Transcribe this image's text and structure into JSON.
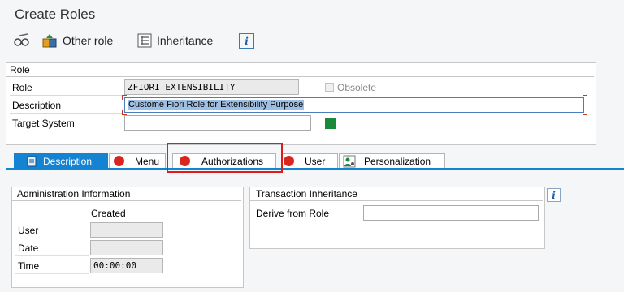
{
  "title": "Create Roles",
  "toolbar": {
    "other_role_label": "Other role",
    "inheritance_label": "Inheritance"
  },
  "role_group": {
    "title": "Role",
    "role_label": "Role",
    "role_value": "ZFIORI_EXTENSIBILITY",
    "obsolete_label": "Obsolete",
    "description_label": "Description",
    "description_value": "Custome Fiori Role for Extensibility Purpose",
    "target_system_label": "Target System",
    "target_system_value": ""
  },
  "tabs": [
    {
      "label": "Description",
      "active": true
    },
    {
      "label": "Menu"
    },
    {
      "label": "Authorizations"
    },
    {
      "label": "User"
    },
    {
      "label": "Personalization"
    }
  ],
  "admin": {
    "title": "Administration Information",
    "column_header": "Created",
    "user_label": "User",
    "user_value": "",
    "date_label": "Date",
    "date_value": "",
    "time_label": "Time",
    "time_value": "00:00:00"
  },
  "inheritance": {
    "title": "Transaction Inheritance",
    "derive_label": "Derive from Role",
    "derive_value": ""
  },
  "colors": {
    "accent_blue": "#1483d2",
    "status_red": "#d9251c",
    "highlight_red": "#e01b1b",
    "status_green": "#1a8a3a"
  }
}
